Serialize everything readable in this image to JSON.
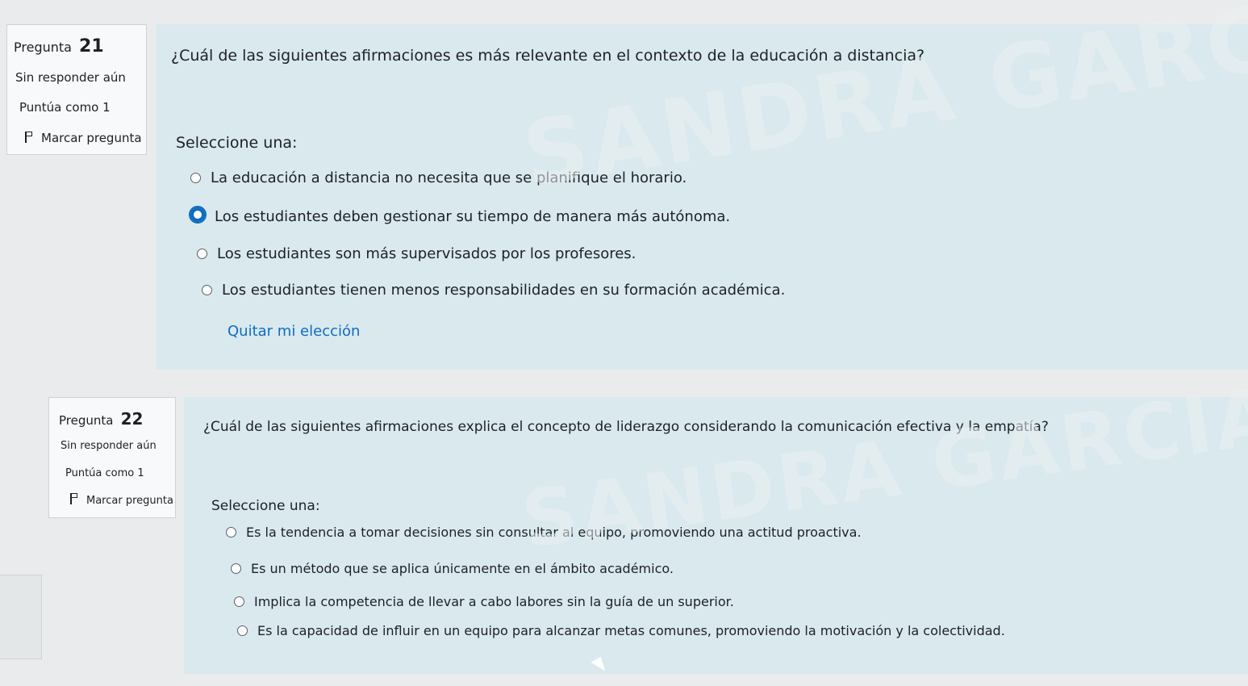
{
  "watermark": "SANDRA GARCIA ZAPATA",
  "q21": {
    "label": "Pregunta",
    "number": "21",
    "status": "Sin responder aún",
    "grade": "Puntúa como 1",
    "flag_label": "Marcar pregunta",
    "question": "¿Cuál de las siguientes afirmaciones es más relevante en el contexto de la educación a distancia?",
    "prompt": "Seleccione una:",
    "options": [
      "La educación a distancia no necesita que se planifique el horario.",
      "Los estudiantes deben gestionar su tiempo de manera más autónoma.",
      "Los estudiantes son más supervisados por los profesores.",
      "Los estudiantes tienen menos responsabilidades en su formación académica."
    ],
    "selected_index": 1,
    "clear_label": "Quitar mi elección"
  },
  "q22": {
    "label": "Pregunta",
    "number": "22",
    "status": "Sin responder aún",
    "grade": "Puntúa como 1",
    "flag_label": "Marcar pregunta",
    "question": "¿Cuál de las siguientes afirmaciones explica el concepto de liderazgo considerando la comunicación efectiva y la empatía?",
    "prompt": "Seleccione una:",
    "options": [
      "Es la tendencia a tomar decisiones sin consultar al equipo, promoviendo una actitud proactiva.",
      "Es un método que se aplica únicamente en el ámbito académico.",
      "Implica la competencia de llevar a cabo labores sin la guía de un superior.",
      "Es la capacidad de influir en un equipo para alcanzar metas comunes, promoviendo la motivación y la colectividad."
    ]
  }
}
